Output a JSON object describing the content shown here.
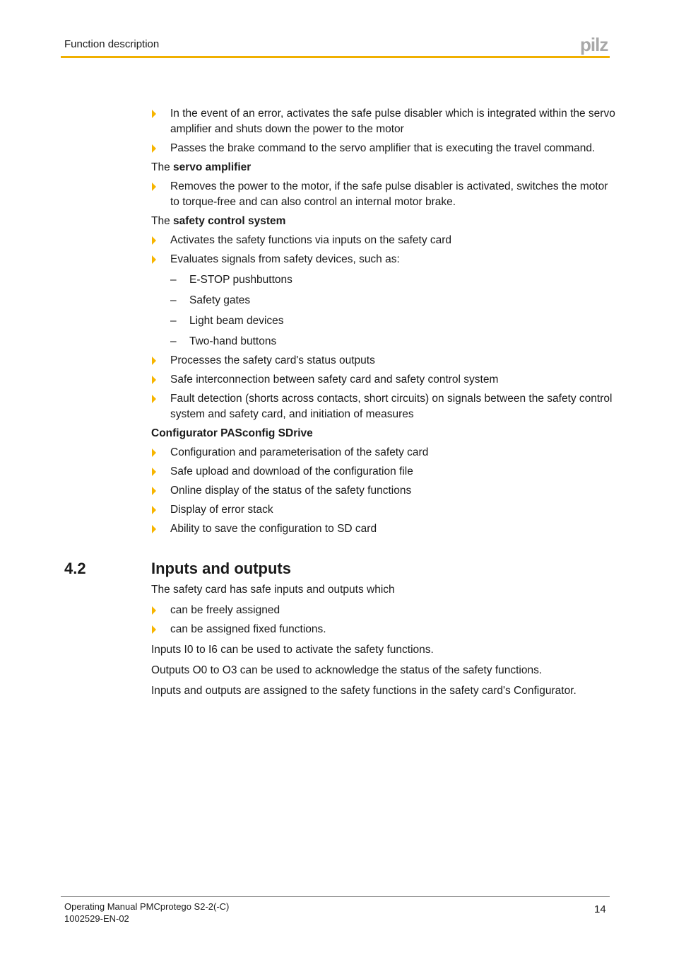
{
  "header": {
    "section_title": "Function description",
    "logo_text": "pilz",
    "accent_color": "#f0b000"
  },
  "intro_bullets": [
    "In the event of an error, activates the safe pulse disabler which is integrated within the servo amplifier and shuts down the power to the motor",
    "Passes the brake command to the servo amplifier that is executing the travel command."
  ],
  "servo_amplifier": {
    "prefix": "The ",
    "heading": "servo amplifier",
    "bullets": [
      "Removes the power to the motor, if the safe pulse disabler is activated, switches the motor to torque-free and can also control an internal motor brake."
    ]
  },
  "safety_control": {
    "prefix": "The ",
    "heading": "safety control system",
    "bullets_before": [
      "Activates the safety functions via inputs on the safety card",
      "Evaluates signals from safety devices, such as:"
    ],
    "sub_items": [
      "E-STOP pushbuttons",
      "Safety gates",
      "Light beam devices",
      "Two-hand buttons"
    ],
    "bullets_after": [
      "Processes the safety card's status outputs",
      "Safe interconnection between safety card and safety control system",
      "Fault detection (shorts across contacts, short circuits) on signals between the safety control system and safety card, and initiation of measures"
    ]
  },
  "configurator": {
    "heading": "Configurator PASconfig SDrive",
    "bullets": [
      "Configuration and parameterisation of the safety card",
      "Safe upload and download of the configuration file",
      "Online display of the status of the safety functions",
      "Display of error stack",
      "Ability to save the configuration to SD card"
    ]
  },
  "section_4_2": {
    "number": "4.2",
    "title": "Inputs and outputs",
    "intro": "The safety card has safe inputs and outputs which",
    "bullets": [
      "can be freely assigned",
      "can be assigned fixed functions."
    ],
    "paragraphs": [
      "Inputs I0 to I6 can be used to activate the safety functions.",
      "Outputs O0 to O3 can be used to acknowledge the status of the safety functions.",
      "Inputs and outputs are assigned to the safety functions in the safety card's Configurator."
    ]
  },
  "footer": {
    "manual_title": "Operating Manual PMCprotego S2-2(-C)",
    "doc_number": "1002529-EN-02",
    "page_number": "14"
  },
  "dash_glyph": "–"
}
